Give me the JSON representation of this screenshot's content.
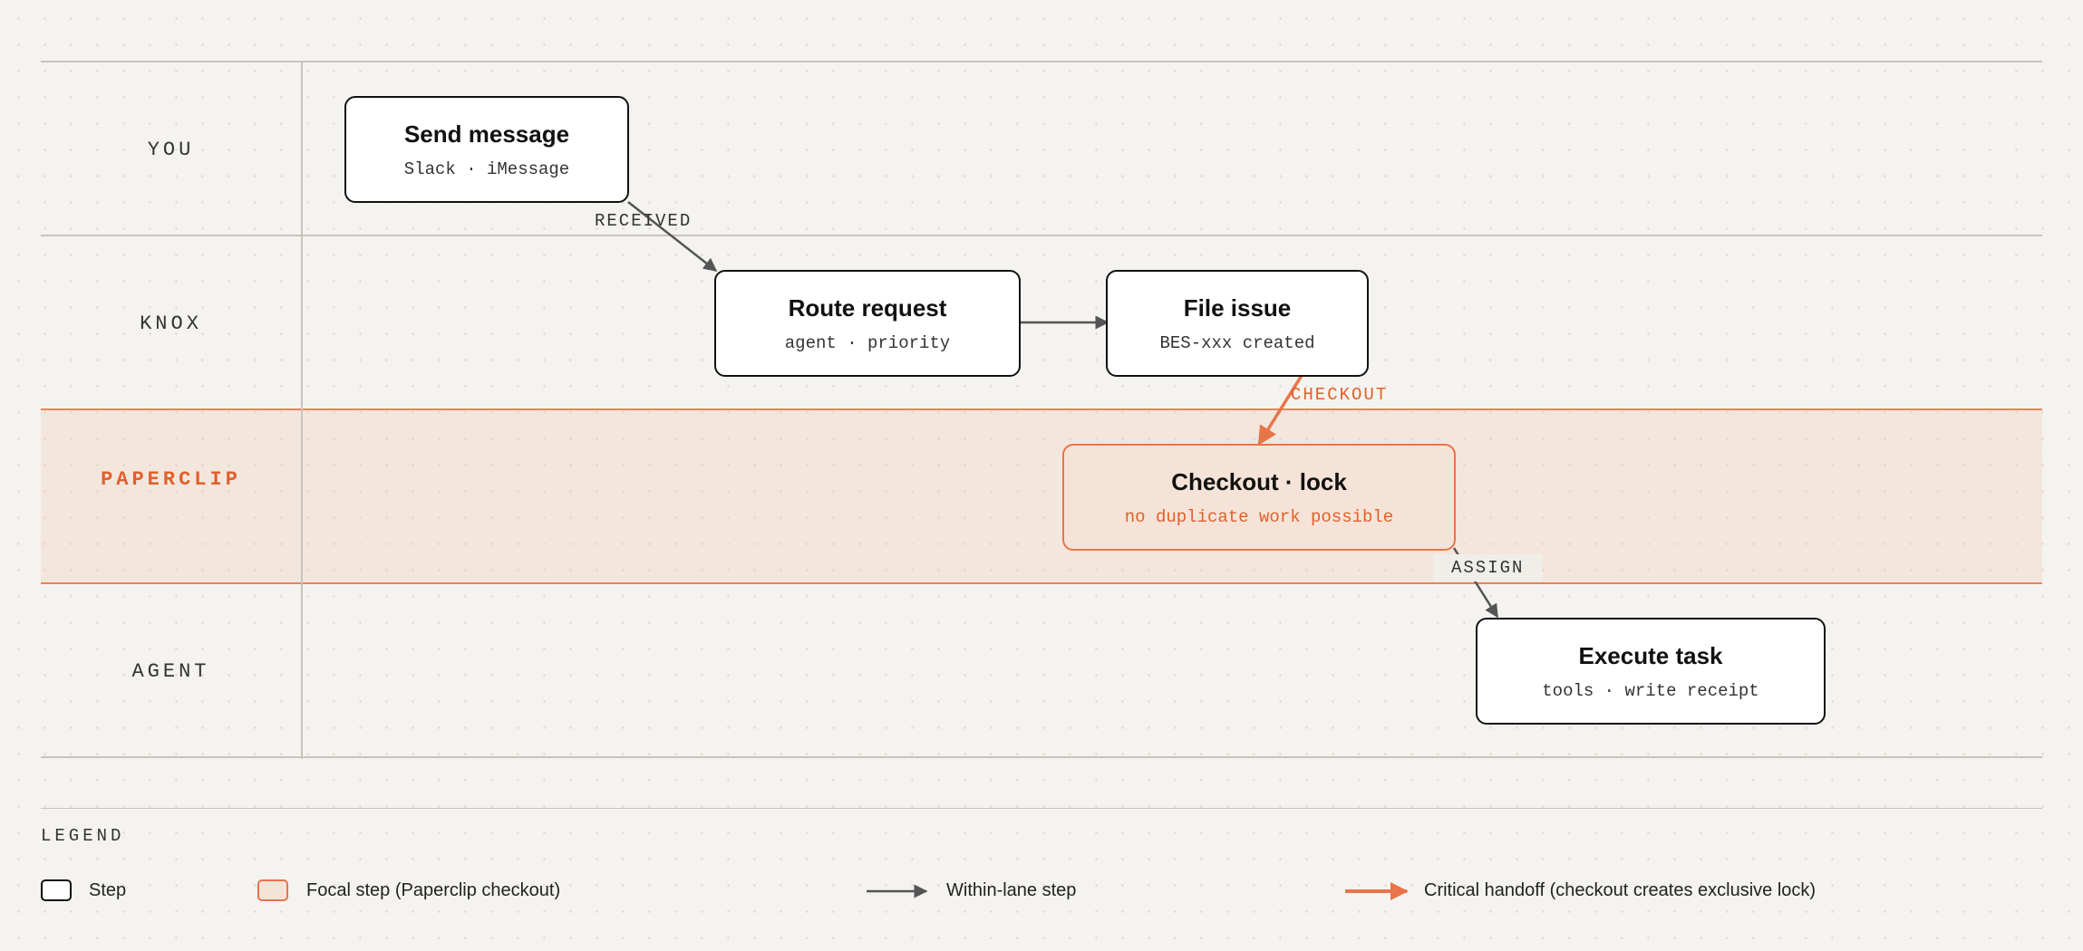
{
  "lanes": [
    {
      "label": "YOU"
    },
    {
      "label": "KNOX"
    },
    {
      "label": "PAPERCLIP"
    },
    {
      "label": "AGENT"
    }
  ],
  "nodes": {
    "send_message": {
      "title": "Send message",
      "subtitle": "Slack · iMessage"
    },
    "route_request": {
      "title": "Route request",
      "subtitle": "agent · priority"
    },
    "file_issue": {
      "title": "File issue",
      "subtitle": "BES-xxx created"
    },
    "checkout_lock": {
      "title": "Checkout · lock",
      "subtitle": "no duplicate work possible"
    },
    "execute_task": {
      "title": "Execute task",
      "subtitle": "tools · write receipt"
    }
  },
  "edges": {
    "received": "RECEIVED",
    "checkout": "CHECKOUT",
    "assign": "ASSIGN"
  },
  "legend": {
    "title": "LEGEND",
    "step": "Step",
    "focal_step": "Focal step (Paperclip checkout)",
    "within_lane": "Within-lane step",
    "critical_handoff": "Critical handoff (checkout creates exclusive lock)"
  },
  "colors": {
    "accent": "#e9744a",
    "focal_fill": "#f6e3d8",
    "ink": "#111111",
    "arrow": "#555555"
  }
}
